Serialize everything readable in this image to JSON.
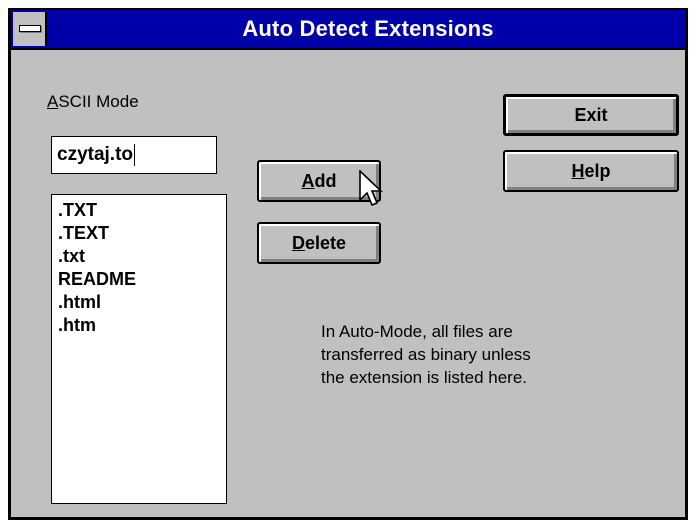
{
  "window": {
    "title": "Auto Detect Extensions"
  },
  "ascii_mode": {
    "label_prefix": "A",
    "label_rest": "SCII Mode"
  },
  "input": {
    "value": "czytaj.to"
  },
  "extensions": [
    ".TXT",
    ".TEXT",
    ".txt",
    "README",
    ".html",
    ".htm"
  ],
  "buttons": {
    "add": {
      "mnemonic": "A",
      "rest": "dd"
    },
    "delete": {
      "mnemonic": "D",
      "rest": "elete"
    },
    "exit": {
      "label": "Exit"
    },
    "help": {
      "mnemonic": "H",
      "rest": "elp"
    }
  },
  "info": {
    "line1": "In Auto-Mode, all files are",
    "line2": "transferred as binary unless",
    "line3": "the extension is listed here."
  },
  "colors": {
    "titlebar": "#0000a8",
    "face": "#c0c0c0"
  },
  "icons": {
    "system_menu": "system-menu-icon",
    "pointer": "mouse-pointer-icon"
  }
}
